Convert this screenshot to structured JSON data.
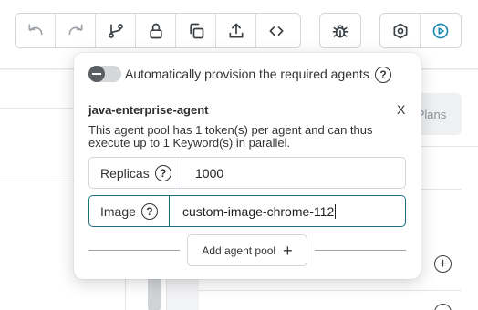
{
  "toolbar": {
    "icons": [
      "undo-icon",
      "redo-icon",
      "branch-icon",
      "lock-icon",
      "copy-icon",
      "upload-icon",
      "code-icon",
      "bug-icon",
      "hexagon-icon",
      "play-icon"
    ],
    "accent_color": "#1a8ab0"
  },
  "background": {
    "plans_label": "Plans"
  },
  "popup": {
    "auto_provision_label": "Automatically provision the required agents",
    "auto_provision_on": false,
    "help_glyph": "?",
    "agent_name": "java-enterprise-agent",
    "close_label": "X",
    "description": "This agent pool has 1 token(s) per agent and can thus execute up to 1 Keyword(s) in parallel.",
    "replicas": {
      "label": "Replicas",
      "value": "1000"
    },
    "image": {
      "label": "Image",
      "value": "custom-image-chrome-112"
    },
    "add_button_label": "Add agent pool",
    "add_button_glyph": "+"
  }
}
